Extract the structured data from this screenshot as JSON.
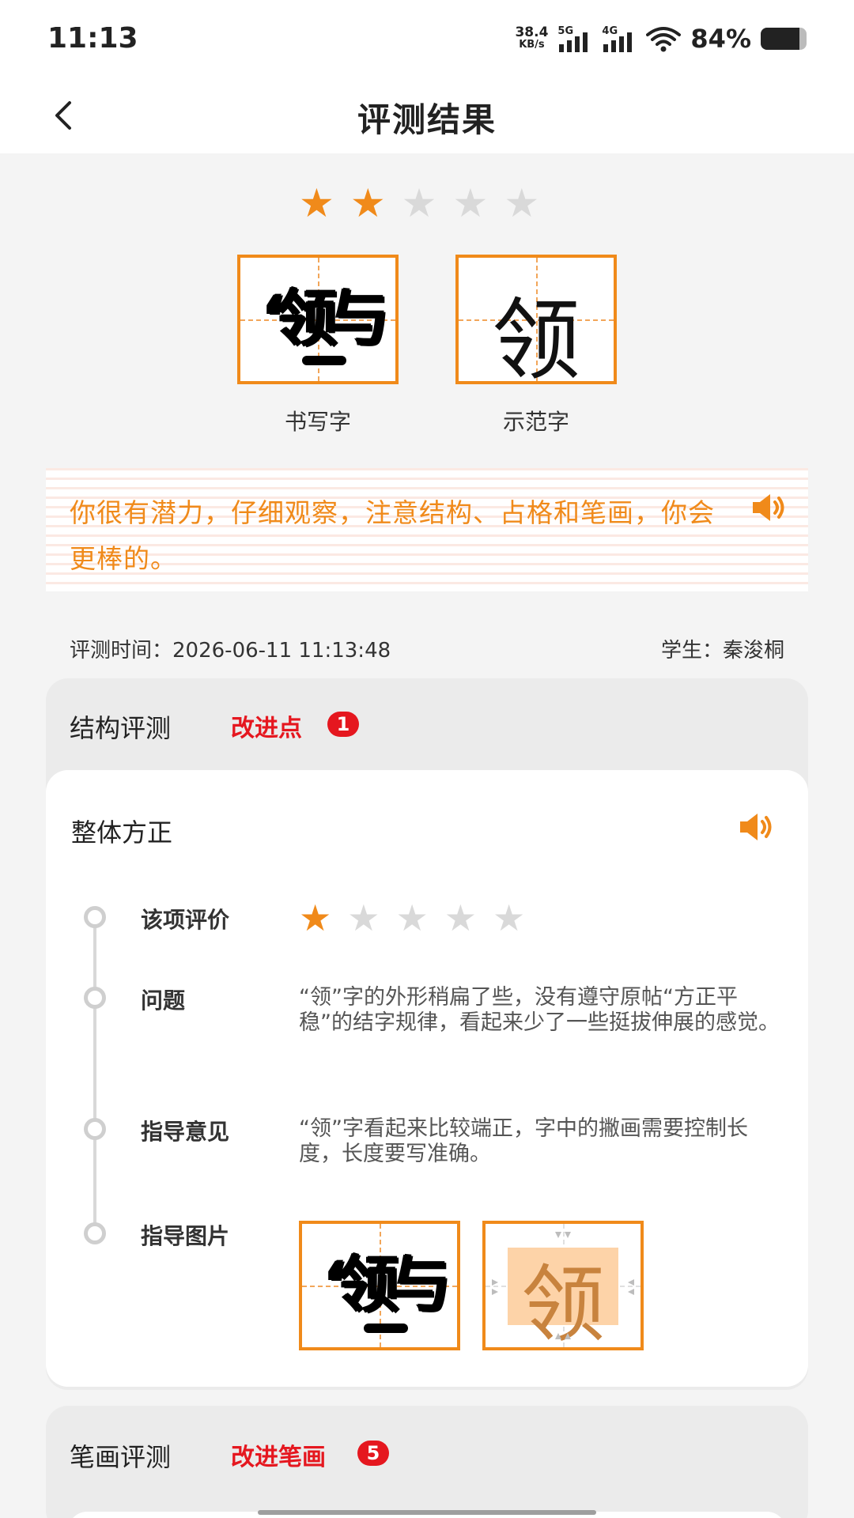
{
  "status_bar": {
    "time": "11:13",
    "net_speed_value": "38.4",
    "net_speed_unit": "KB/s",
    "sim1_label": "5G",
    "sim2_label": "4G",
    "battery_text": "84%",
    "battery_level": 0.84
  },
  "header": {
    "title": "评测结果",
    "back_icon": "chevron-left-icon"
  },
  "overall_rating": {
    "value": 2,
    "max": 5
  },
  "characters": {
    "written_label": "书写字",
    "model_label": "示范字",
    "model_char": "领",
    "written_glyph": "‘领与"
  },
  "feedback": {
    "text": "你很有潜力，仔细观察，注意结构、占格和笔画，你会更棒的。",
    "speaker_icon": "speaker-icon"
  },
  "meta": {
    "time_label": "评测时间：",
    "time_value": "2026-06-11 11:13:48",
    "student_label": "学生：",
    "student_name": "秦浚桐"
  },
  "structure_section": {
    "title": "结构评测",
    "tag": "改进点",
    "badge": "1",
    "card_title": "整体方正",
    "items": [
      {
        "label": "该项评价",
        "rating": 1,
        "max": 5
      },
      {
        "label": "问题",
        "text": "“领”字的外形稍扁了些，没有遵守原帖“方正平稳”的结字规律，看起来少了一些挺拔伸展的感觉。"
      },
      {
        "label": "指导意见",
        "text": "“领”字看起来比较端正，字中的撇画需要控制长度，长度要写准确。"
      },
      {
        "label": "指导图片"
      }
    ]
  },
  "stroke_section": {
    "title": "笔画评测",
    "tag": "改进笔画",
    "badge": "5"
  },
  "colors": {
    "accent": "#f08a1a",
    "alert": "#e5171f",
    "star_off": "#d9d9d9",
    "feedback_bg": "#fbe9e3"
  }
}
